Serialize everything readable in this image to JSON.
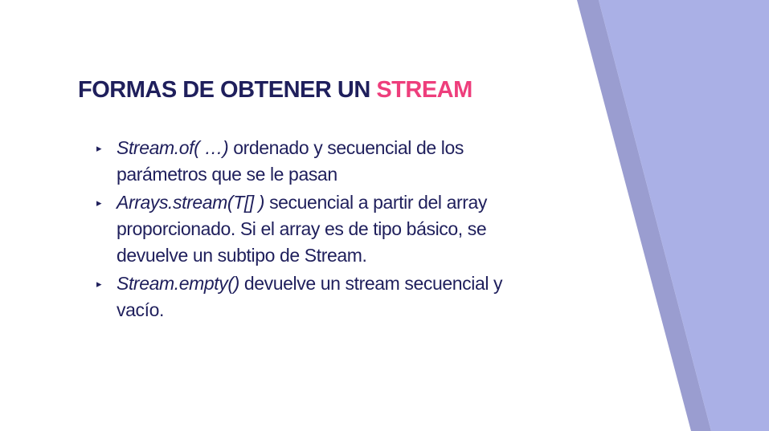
{
  "slide": {
    "title_main": "FORMAS DE OBTENER UN ",
    "title_accent": "STREAM",
    "bullet_marker": "▸",
    "colors": {
      "text": "#1f1f5c",
      "accent": "#ee3e7c",
      "deco_light": "#aab0e6",
      "deco_dark": "#9a9dd0",
      "background": "#ffffff"
    },
    "bullets": [
      {
        "code": "Stream.of( …)",
        "text": " ordenado y secuencial de los parámetros que se le pasan"
      },
      {
        "code": "Arrays.stream(T[] )",
        "text": " secuencial a partir del array proporcionado. Si el array es de tipo básico, se devuelve un subtipo de Stream."
      },
      {
        "code": "Stream.empty()",
        "text": " devuelve un stream secuencial y vacío."
      }
    ]
  }
}
